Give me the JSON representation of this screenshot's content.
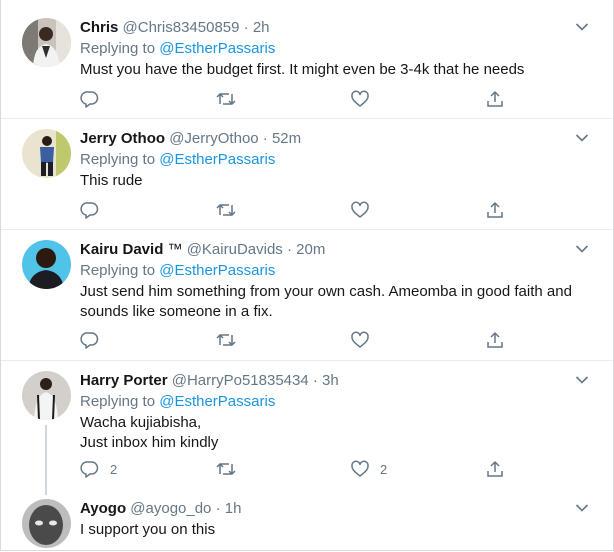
{
  "tweets": [
    {
      "name": "Chris",
      "badge": "",
      "handle": "@Chris83450859",
      "sep": " · ",
      "time": "2h",
      "replying_prefix": "Replying to ",
      "replying_to": "@EstherPassaris",
      "text_lines": [
        "Must you have the budget first. It might even be 3-4k that he needs"
      ],
      "replies": "",
      "likes": ""
    },
    {
      "name": "Jerry Othoo",
      "badge": "",
      "handle": "@JerryOthoo",
      "sep": " · ",
      "time": "52m",
      "replying_prefix": "Replying to ",
      "replying_to": "@EstherPassaris",
      "text_lines": [
        "This rude"
      ],
      "replies": "",
      "likes": ""
    },
    {
      "name": "Kairu David",
      "badge": "™",
      "handle": "@KairuDavids",
      "sep": " · ",
      "time": "20m",
      "replying_prefix": "Replying to ",
      "replying_to": "@EstherPassaris",
      "text_lines": [
        "Just send him something from your own cash. Ameomba in good faith and",
        "sounds like someone in a fix."
      ],
      "replies": "",
      "likes": ""
    },
    {
      "name": "Harry Porter",
      "badge": "",
      "handle": "@HarryPo51835434",
      "sep": " · ",
      "time": "3h",
      "replying_prefix": "Replying to ",
      "replying_to": "@EstherPassaris",
      "text_lines": [
        "Wacha kujiabisha,",
        "Just inbox him kindly"
      ],
      "replies": "2",
      "likes": "2"
    },
    {
      "name": "Ayogo",
      "badge": "",
      "handle": "@ayogo_do",
      "sep": " · ",
      "time": "1h",
      "replying_prefix": "",
      "replying_to": "",
      "text_lines": [
        "I support you on this"
      ],
      "replies": "",
      "likes": ""
    }
  ],
  "icons": {
    "reply": "reply-icon",
    "retweet": "retweet-icon",
    "like": "like-icon",
    "share": "share-icon",
    "more": "chevron-down-icon"
  },
  "colors": {
    "name": "#14171a",
    "secondary": "#657786",
    "link": "#1b95e0",
    "divider": "#e6ecf0",
    "thread_line": "#ccd6dd"
  }
}
